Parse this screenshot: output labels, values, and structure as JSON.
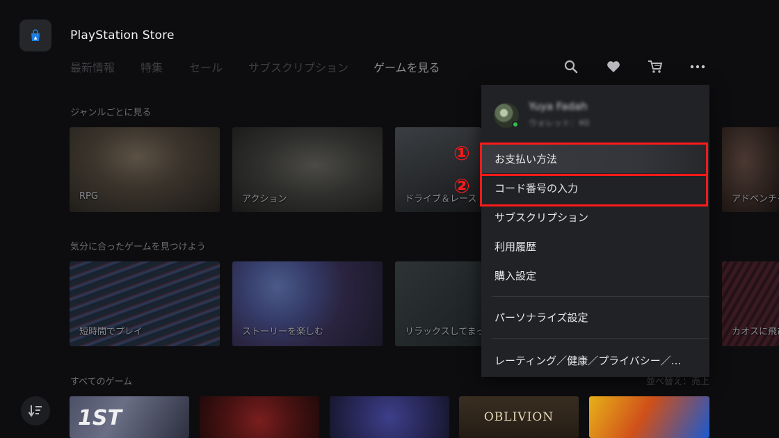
{
  "header": {
    "app_title": "PlayStation Store",
    "tabs": [
      {
        "label": "最新情報",
        "active": false
      },
      {
        "label": "特集",
        "active": false
      },
      {
        "label": "セール",
        "active": false
      },
      {
        "label": "サブスクリプション",
        "active": false
      },
      {
        "label": "ゲームを見る",
        "active": true
      }
    ],
    "icons": [
      "search-icon",
      "heart-icon",
      "cart-icon",
      "more-icon"
    ]
  },
  "sections": {
    "genre": {
      "label": "ジャンルごとに見る",
      "tiles": [
        "RPG",
        "アクション",
        "ドライブ＆レース",
        "アドベンチャー"
      ]
    },
    "mood": {
      "label": "気分に合ったゲームを見つけよう",
      "tiles": [
        "短時間でプレイ",
        "ストーリーを楽しむ",
        "リラックスしてまったり",
        "カオスに飛び込む"
      ]
    },
    "all_games": {
      "label": "すべてのゲーム",
      "sort_label": "並べ替え：売上",
      "tiles": [
        "1ST",
        "",
        "",
        "OBLIVION",
        ""
      ]
    }
  },
  "menu": {
    "user_name": "Yuya Fadah",
    "user_sub": "ウォレット：¥0",
    "items": [
      "お支払い方法",
      "コード番号の入力",
      "サブスクリプション",
      "利用履歴",
      "購入設定",
      "パーソナライズ設定",
      "レーティング／健康／プライバシー／..."
    ]
  },
  "annotations": {
    "markers": [
      "①",
      "②"
    ],
    "color": "#ff1a1a"
  },
  "colors": {
    "background": "#0d0d0f",
    "menu_bg": "#212226",
    "highlight": "#ff1a1a"
  }
}
